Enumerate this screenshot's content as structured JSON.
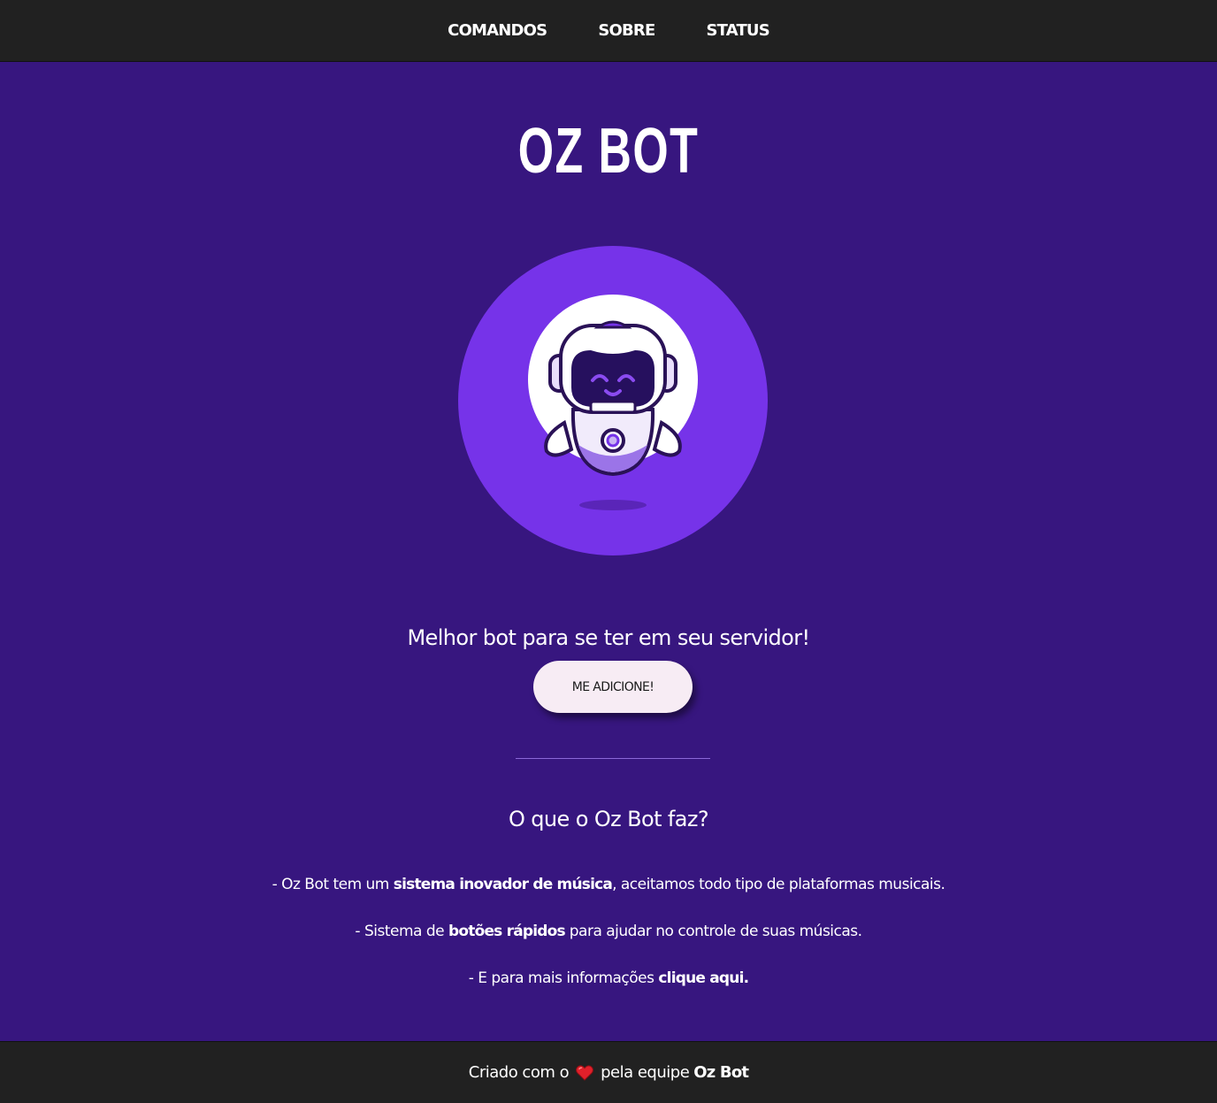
{
  "nav": {
    "items": [
      {
        "label": "COMANDOS"
      },
      {
        "label": "SOBRE"
      },
      {
        "label": "STATUS"
      }
    ]
  },
  "hero": {
    "title": "OZ BOT",
    "tagline": "Melhor bot para se ter em seu servidor!",
    "cta_label": "ME ADICIONE!",
    "logo_icon": "robot-mascot-icon"
  },
  "features": {
    "heading": "O que o Oz Bot faz?",
    "items": [
      {
        "prefix": "- Oz Bot tem um ",
        "highlight": "sistema inovador de música",
        "suffix": ", aceitamos todo tipo de plataformas musicais."
      },
      {
        "prefix": "- Sistema de ",
        "highlight": "botões rápidos",
        "suffix": " para ajudar no controle de suas músicas."
      },
      {
        "prefix": "- E para mais informações ",
        "highlight": "clique aqui.",
        "suffix": ""
      }
    ]
  },
  "footer": {
    "prefix": "Criado com o",
    "middle": "pela equipe",
    "brand": "Oz Bot",
    "heart_icon": "heart-icon"
  },
  "colors": {
    "background": "#37167f",
    "bar": "#212121",
    "accent": "#7633e9",
    "button": "#f7ecf4",
    "heart": "#e0202a"
  }
}
